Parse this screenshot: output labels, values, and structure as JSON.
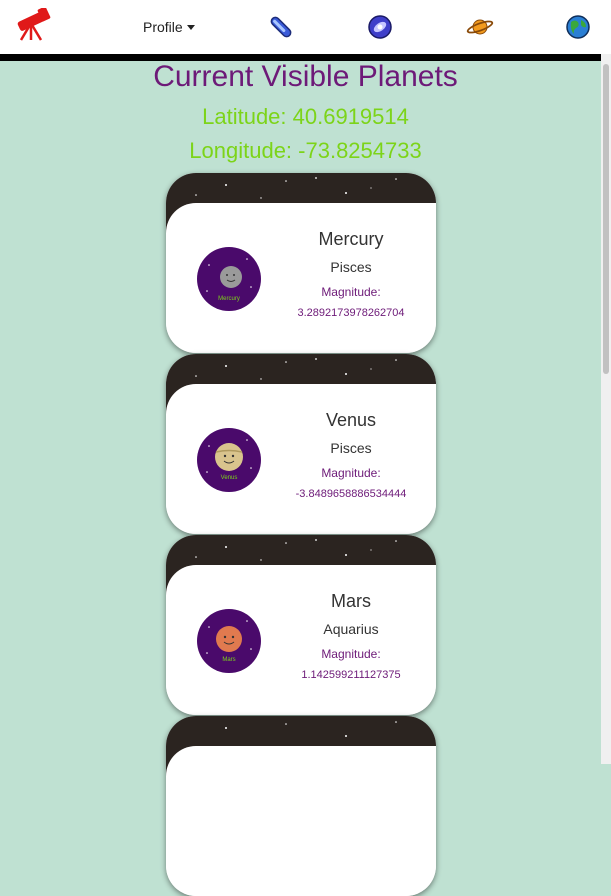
{
  "nav": {
    "profile_label": "Profile"
  },
  "page": {
    "title": "Current Visible Planets",
    "latitude": "Latitude: 40.6919514",
    "longitude": "Longitude: -73.8254733"
  },
  "planets": [
    {
      "name": "Mercury",
      "constellation": "Pisces",
      "magnitude_label": "Magnitude:",
      "magnitude": "3.2892173978262704",
      "thumb_label": "Mercury",
      "color": "#9a9a9a"
    },
    {
      "name": "Venus",
      "constellation": "Pisces",
      "magnitude_label": "Magnitude:",
      "magnitude": "-3.8489658886534444",
      "thumb_label": "Venus",
      "color": "#d9c48d"
    },
    {
      "name": "Mars",
      "constellation": "Aquarius",
      "magnitude_label": "Magnitude:",
      "magnitude": "1.142599211127375",
      "thumb_label": "Mars",
      "color": "#e07a4f"
    }
  ],
  "colors": {
    "background": "#bfe1d2",
    "title": "#6d1a78",
    "coordinates": "#7cd419",
    "thumb_background": "#4a0a6b"
  }
}
